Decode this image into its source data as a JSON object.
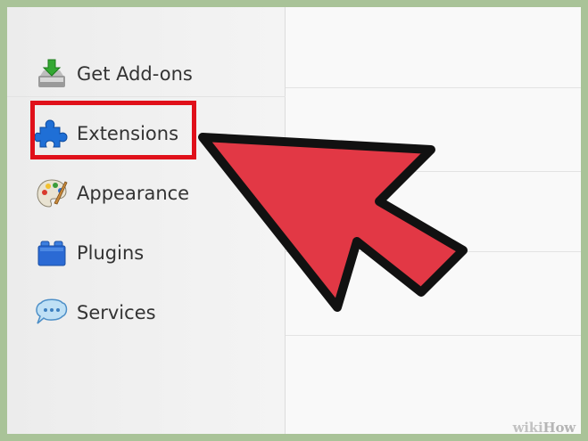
{
  "sidebar": {
    "items": [
      {
        "label": "Get Add-ons",
        "icon": "download-icon"
      },
      {
        "label": "Extensions",
        "icon": "puzzle-piece-icon"
      },
      {
        "label": "Appearance",
        "icon": "paint-palette-icon"
      },
      {
        "label": "Plugins",
        "icon": "lego-brick-icon"
      },
      {
        "label": "Services",
        "icon": "speech-bubble-icon"
      }
    ]
  },
  "colors": {
    "highlight": "#e0101a",
    "arrow_fill": "#e23845",
    "arrow_outline": "#111111"
  },
  "watermark": {
    "part1": "wiki",
    "part2": "How"
  }
}
